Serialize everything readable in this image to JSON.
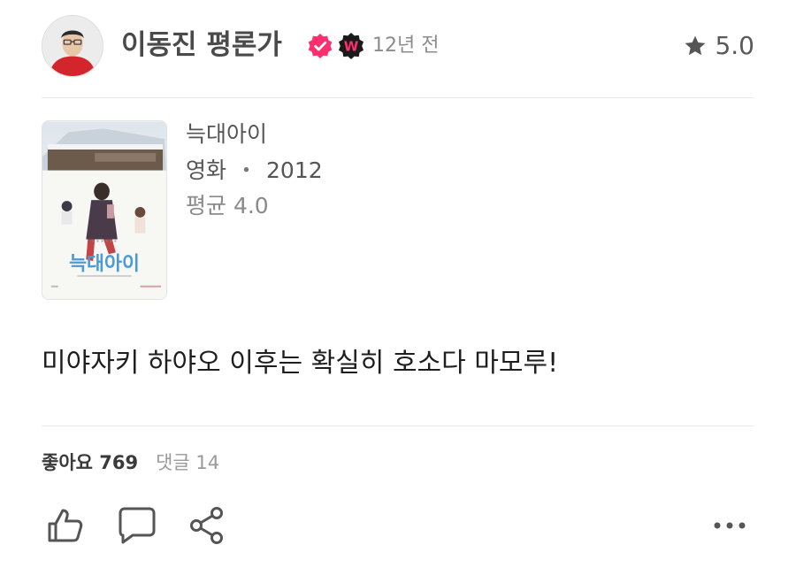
{
  "author": {
    "name": "이동진 평론가",
    "badge_letter": "W",
    "time_ago": "12년 전",
    "verified_color": "#ff2f6e"
  },
  "rating": {
    "value": "5.0",
    "icon": "star-icon"
  },
  "movie": {
    "title": "늑대아이",
    "type": "영화",
    "separator": "・",
    "year": "2012",
    "average": "평균 4.0",
    "poster_title": "늑대아이"
  },
  "review": {
    "text": "미야자키 하야오 이후는 확실히 호소다 마모루!"
  },
  "stats": {
    "likes": "좋아요 769",
    "comments": "댓글 14"
  },
  "actions": [
    "thumbs-up-icon",
    "comment-icon",
    "share-icon",
    "more-icon"
  ],
  "colors": {
    "accent": "#ff2f6e",
    "badge_bg": "#1a1a1a",
    "text_secondary": "#8c8c8c"
  }
}
